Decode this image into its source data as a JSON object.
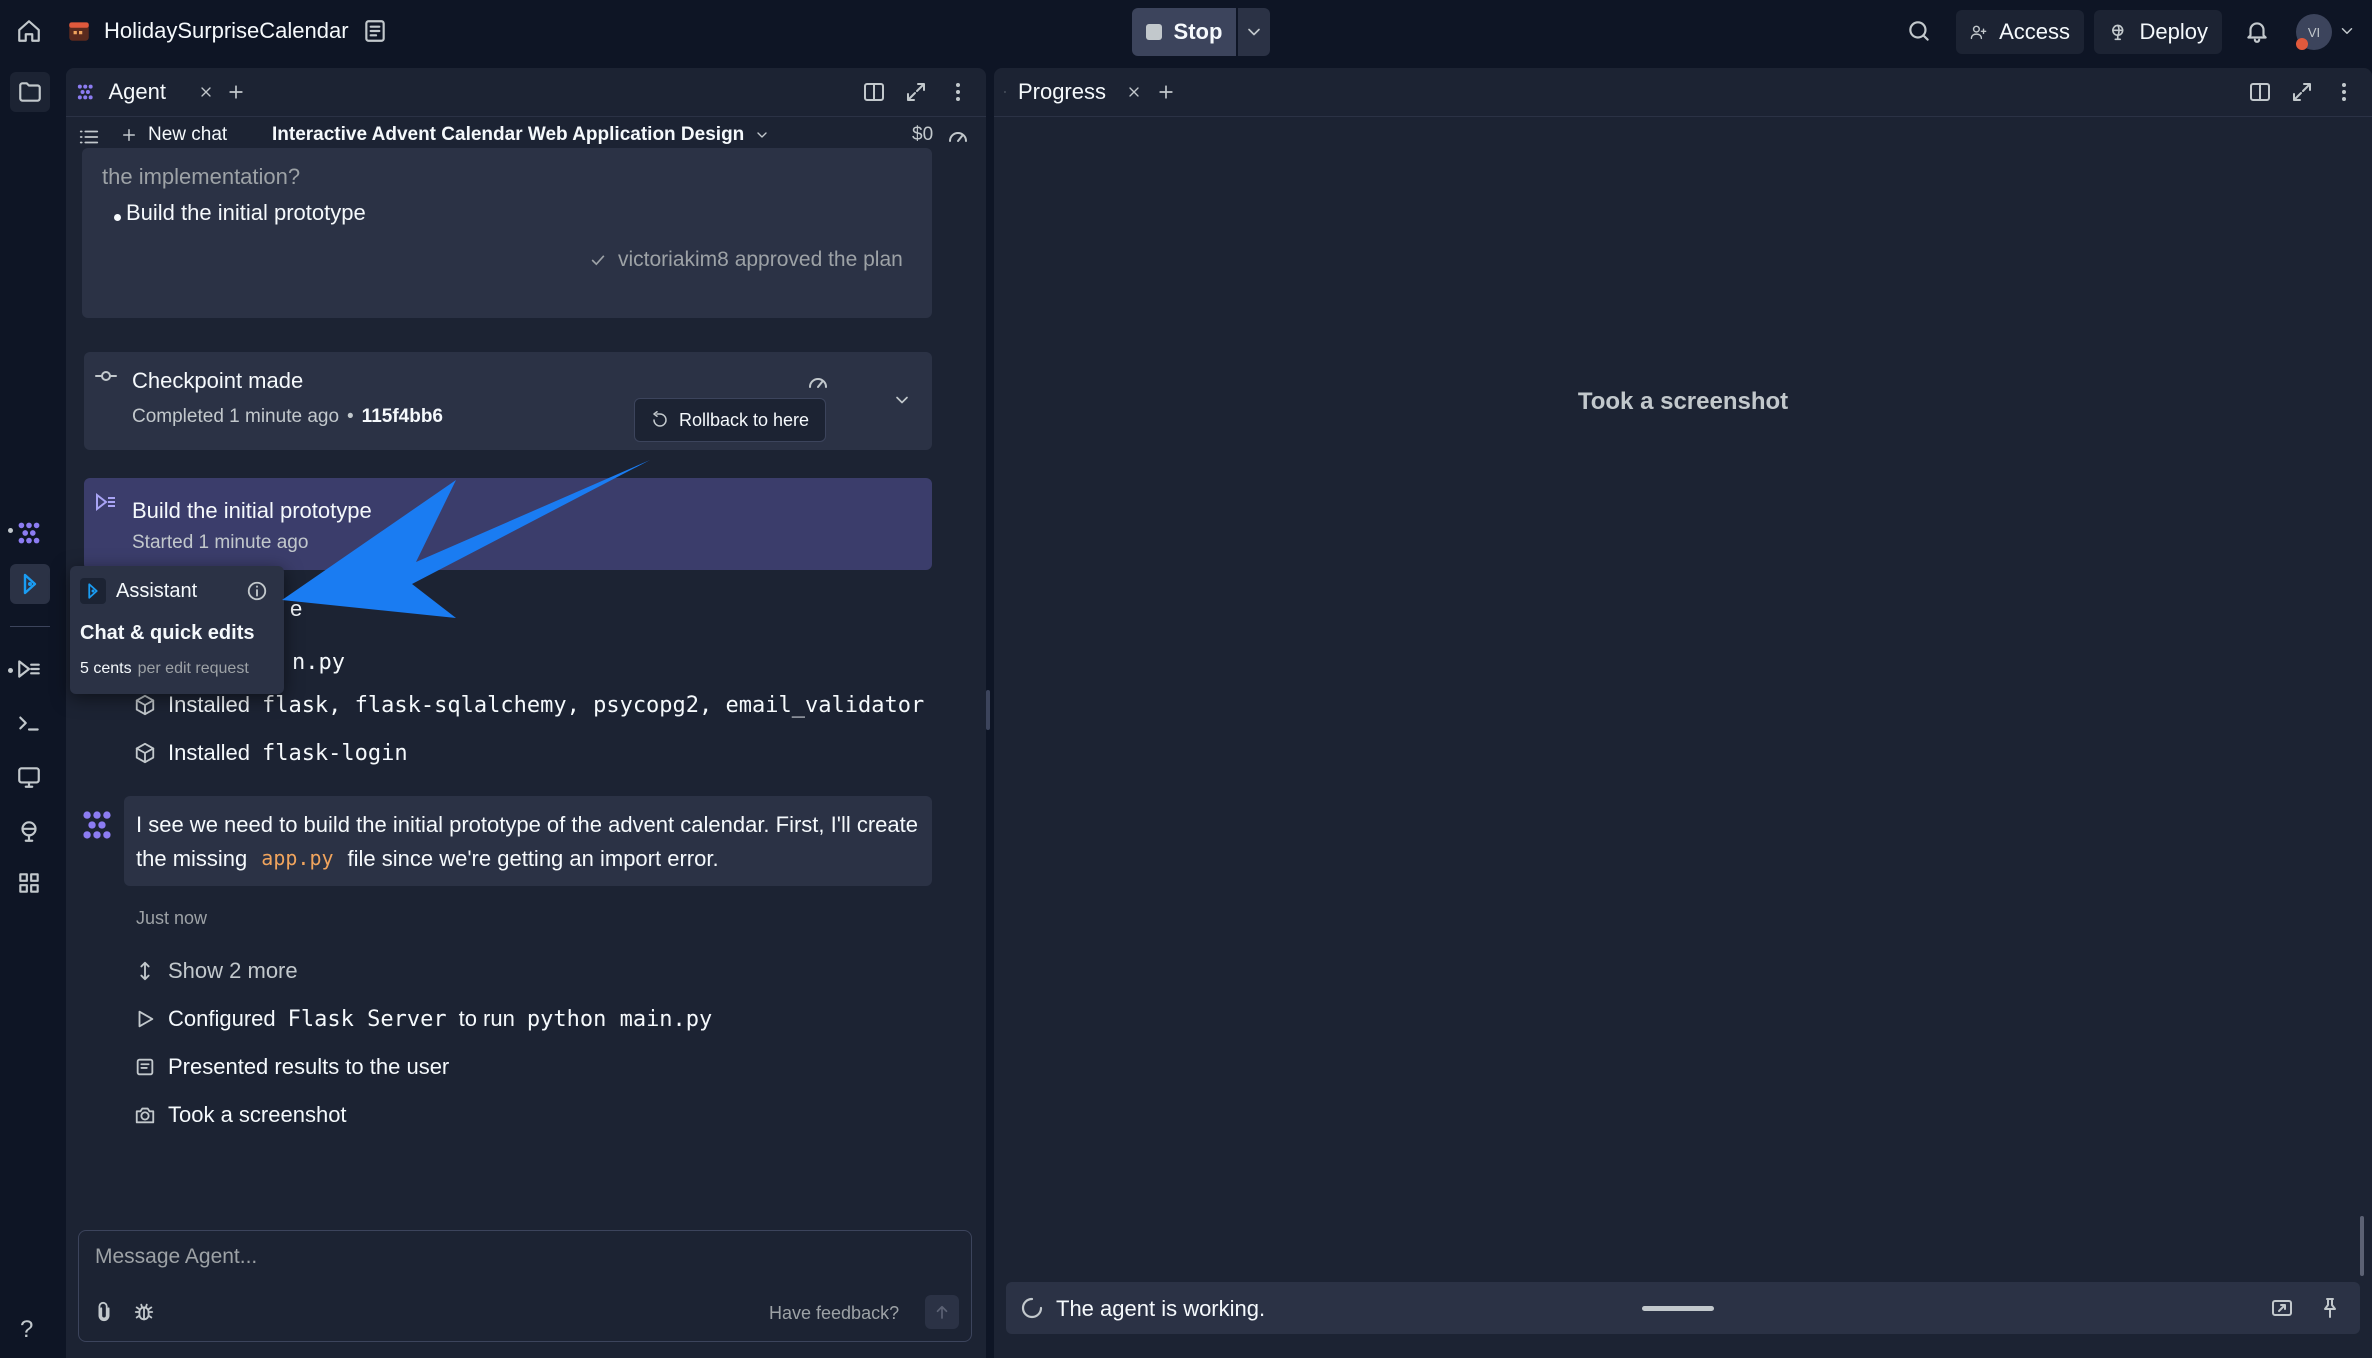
{
  "app": {
    "title": "HolidaySurpriseCalendar"
  },
  "header": {
    "stop_label": "Stop",
    "access_label": "Access",
    "deploy_label": "Deploy",
    "avatar_initials": "VI"
  },
  "agent_tab": {
    "label": "Agent"
  },
  "chat_toolbar": {
    "new_chat_label": "New chat",
    "chat_title": "Interactive Advent Calendar Web Application Design",
    "cost": "$0"
  },
  "plan": {
    "cut_text": "the implementation?",
    "bullet": "Build the initial prototype",
    "approval": "victoriakim8 approved the plan"
  },
  "checkpoint": {
    "title": "Checkpoint made",
    "meta_prefix": "Completed 1 minute ago",
    "sep": "•",
    "hash": "115f4bb6",
    "rollback_label": "Rollback to here"
  },
  "task": {
    "title": "Build the initial prototype",
    "subtitle": "Started 1 minute ago"
  },
  "actions_top": [
    {
      "partial": "e"
    },
    {
      "partial": "n.py"
    }
  ],
  "installs": [
    {
      "prefix": "Installed",
      "code": "flask, flask-sqlalchemy, psycopg2, email_validator"
    },
    {
      "prefix": "Installed",
      "code": "flask-login"
    }
  ],
  "agent_message": {
    "line1": "I see we need to build the initial prototype of the advent calendar. First, I'll create",
    "line2_pre": "the missing",
    "code": "app.py",
    "line2_post": "file since we're getting an import error.",
    "time": "Just now"
  },
  "actions_bottom": {
    "show_more": "Show 2 more",
    "configured_pre": "Configured",
    "configured_code1": "Flask Server",
    "configured_mid": "to run",
    "configured_code2": "python main.py",
    "presented": "Presented results to the user",
    "screenshot": "Took a screenshot"
  },
  "tooltip": {
    "title": "Assistant",
    "heading": "Chat & quick edits",
    "price_bold": "5 cents",
    "price_rest": "per edit request"
  },
  "composer": {
    "placeholder": "Message Agent...",
    "feedback": "Have feedback?"
  },
  "progress": {
    "tab_label": "Progress",
    "center_text": "Took a screenshot",
    "status": "The agent is working."
  },
  "colors": {
    "bg": "#0e1525",
    "panel": "#1c2333",
    "card": "#2b3245",
    "task_card": "#3b3d6b",
    "accent_purple": "#8c7cf2",
    "code_orange": "#f0a45d",
    "arrow_blue": "#1a7cf2"
  }
}
